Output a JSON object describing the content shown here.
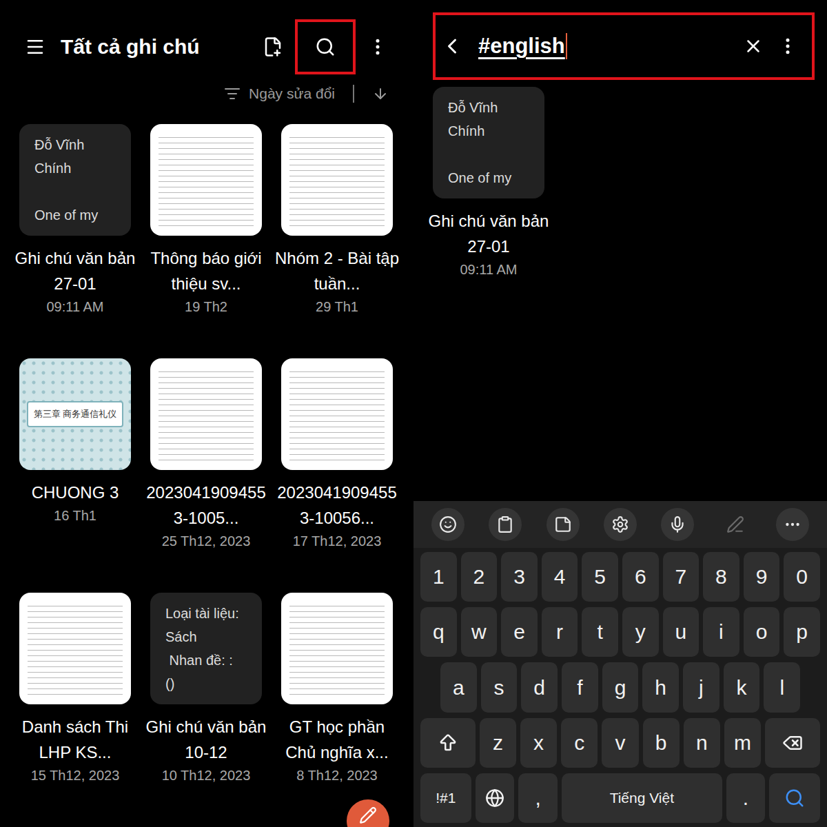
{
  "notes_screen": {
    "title": "Tất cả ghi chú",
    "search_highlighted": true,
    "sort": {
      "label": "Ngày sửa đổi"
    },
    "notes": [
      {
        "kind": "text",
        "preview": [
          "Đỗ Vĩnh",
          "Chính",
          "",
          "One of my"
        ],
        "title": "Ghi chú văn bản 27-01",
        "date": "09:11 AM"
      },
      {
        "kind": "document",
        "title": "Thông báo giới thiệu sv...",
        "date": "19 Th2"
      },
      {
        "kind": "document",
        "title": "Nhóm 2 - Bài tập tuần...",
        "date": "29 Th1"
      },
      {
        "kind": "image",
        "label": "第三章 商务通信礼仪",
        "title": "CHUONG 3",
        "date": "16 Th1"
      },
      {
        "kind": "document",
        "title": "20230419094553-1005...",
        "date": "25 Th12, 2023"
      },
      {
        "kind": "document",
        "title": "20230419094553-10056...",
        "date": "17 Th12, 2023"
      },
      {
        "kind": "document",
        "title": "Danh sách Thi LHP KS...",
        "date": "15 Th12, 2023"
      },
      {
        "kind": "text",
        "preview": [
          "Loại tài liệu:",
          "Sách",
          " Nhan đề: :",
          "()"
        ],
        "title": "Ghi chú văn bản 10-12",
        "date": "10 Th12, 2023"
      },
      {
        "kind": "document",
        "title": "GT học phần Chủ nghĩa x...",
        "date": "8 Th12, 2023"
      }
    ]
  },
  "search_screen": {
    "query": "#english",
    "focused": true,
    "highlighted": true,
    "results": [
      {
        "kind": "text",
        "preview": [
          "Đỗ Vĩnh",
          "Chính",
          "",
          "One of my"
        ],
        "title": "Ghi chú văn bản 27-01",
        "date": "09:11 AM"
      }
    ]
  },
  "keyboard": {
    "toolbar": [
      {
        "disabled": false
      },
      {
        "disabled": false
      },
      {
        "disabled": false
      },
      {
        "disabled": false
      },
      {
        "disabled": false
      },
      {
        "disabled": true
      },
      {
        "disabled": false
      }
    ],
    "number_row": [
      "1",
      "2",
      "3",
      "4",
      "5",
      "6",
      "7",
      "8",
      "9",
      "0"
    ],
    "rows": [
      [
        "q",
        "w",
        "e",
        "r",
        "t",
        "y",
        "u",
        "i",
        "o",
        "p"
      ],
      [
        "a",
        "s",
        "d",
        "f",
        "g",
        "h",
        "j",
        "k",
        "l"
      ],
      [
        "z",
        "x",
        "c",
        "v",
        "b",
        "n",
        "m"
      ]
    ],
    "bottom_row": {
      "symbols": "!#1",
      "comma": ",",
      "space": "Tiếng Việt",
      "period": "."
    }
  }
}
